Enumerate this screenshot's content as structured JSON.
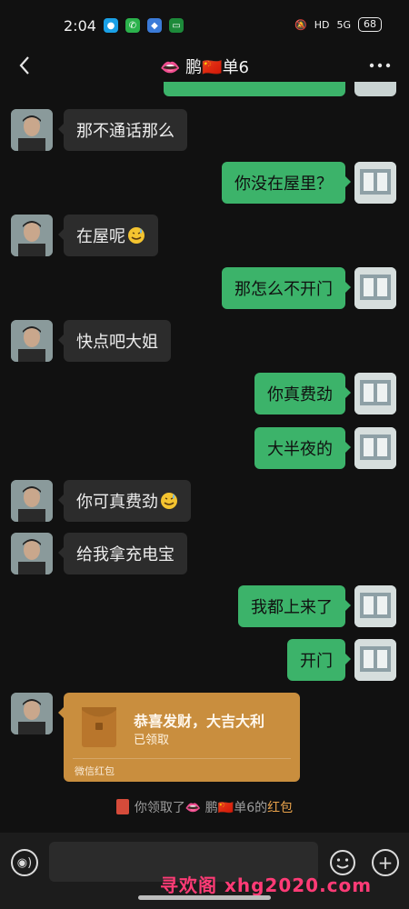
{
  "status_bar": {
    "time": "2:04",
    "network": "5G",
    "hd": "HD",
    "battery": "68"
  },
  "header": {
    "title_prefix": "👄",
    "title_name": "鹏",
    "title_flag": "🇨🇳",
    "title_suffix": "单6"
  },
  "messages": [
    {
      "side": "left",
      "text": "那不通话那么"
    },
    {
      "side": "right",
      "text": "你没在屋里？"
    },
    {
      "side": "left",
      "text": "在屋呢",
      "emoji": "sweat-face"
    },
    {
      "side": "right",
      "text": "那怎么不开门"
    },
    {
      "side": "left",
      "text": "快点吧大姐"
    },
    {
      "side": "right",
      "text": "你真费劲"
    },
    {
      "side": "right",
      "text": "大半夜的"
    },
    {
      "side": "left",
      "text": "你可真费劲",
      "emoji": "sweat-face"
    },
    {
      "side": "left",
      "text": "给我拿充电宝"
    },
    {
      "side": "right",
      "text": "我都上来了"
    },
    {
      "side": "right",
      "text": "开门"
    }
  ],
  "red_packet": {
    "title": "恭喜发财，大吉大利",
    "status": "已领取",
    "footer": "微信红包"
  },
  "system_notice": {
    "prefix": "你领取了👄 鹏",
    "flag": "🇨🇳",
    "middle": "单6的",
    "link": "红包"
  },
  "watermark": "寻欢阁 xhg2020.com",
  "colors": {
    "background": "#111111",
    "my_bubble": "#3cb36a",
    "their_bubble": "#2c2c2c",
    "red_packet": "#c98e3e",
    "link": "#e8a24b"
  }
}
